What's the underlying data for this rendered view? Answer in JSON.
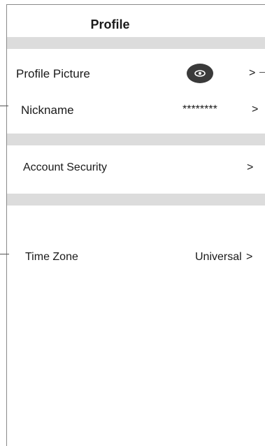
{
  "header": {
    "title": "Profile"
  },
  "rows": {
    "profile_picture": {
      "label": "Profile Picture",
      "chevron": ">"
    },
    "nickname": {
      "label": "Nickname",
      "value": "********",
      "chevron": ">"
    },
    "account_security": {
      "label": "Account Security",
      "chevron": ">"
    },
    "time_zone": {
      "label": "Time Zone",
      "value": "Universal",
      "chevron": ">"
    }
  },
  "colors": {
    "divider": "#dcdcdc",
    "avatar": "#3a3a3a",
    "frame": "#8a8a8a"
  },
  "icons": {
    "avatar": "eye-icon"
  }
}
